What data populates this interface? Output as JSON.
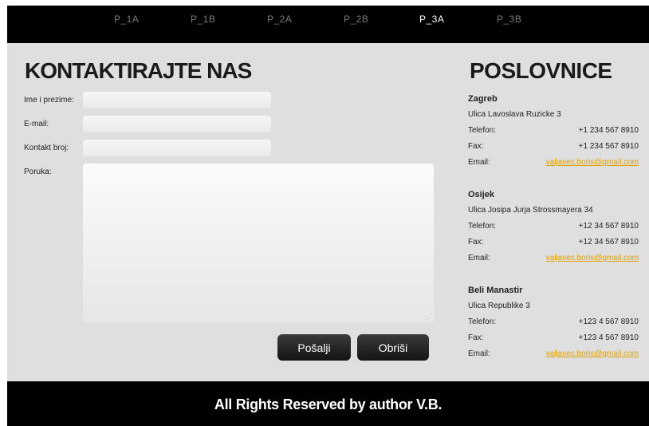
{
  "nav": {
    "items": [
      {
        "label": "P_1A",
        "active": false
      },
      {
        "label": "P_1B",
        "active": false
      },
      {
        "label": "P_2A",
        "active": false
      },
      {
        "label": "P_2B",
        "active": false
      },
      {
        "label": "P_3A",
        "active": true
      },
      {
        "label": "P_3B",
        "active": false
      }
    ]
  },
  "contact": {
    "title": "KONTAKTIRAJTE NAS",
    "fields": {
      "name_label": "Ime i prezime:",
      "email_label": "E-mail:",
      "phone_label": "Kontakt broj:",
      "message_label": "Poruka:",
      "name_value": "",
      "email_value": "",
      "phone_value": "",
      "message_value": ""
    },
    "buttons": {
      "send": "Pošalji",
      "clear": "Obriši"
    }
  },
  "offices": {
    "title": "POSLOVNICE",
    "phone_label": "Telefon:",
    "fax_label": "Fax:",
    "email_label": "Email:",
    "items": [
      {
        "city": "Zagreb",
        "address": "Ulica Lavoslava Ruzicke 3",
        "phone": "+1 234 567 8910",
        "fax": "+1 234 567 8910",
        "email": "valjavec.boris@gmail.com"
      },
      {
        "city": "Osijek",
        "address": "Ulica Josipa Jurja Strossmayera 34",
        "phone": "+12 34 567 8910",
        "fax": "+12 34 567 8910",
        "email": "valjavec.boris@gmail.com"
      },
      {
        "city": "Beli Manastir",
        "address": "Ulica Republike 3",
        "phone": "+123 4 567 8910",
        "fax": "+123 4 567 8910",
        "email": "valjavec.boris@gmail.com"
      }
    ]
  },
  "footer": {
    "text": "All Rights Reserved by author V.B."
  },
  "colors": {
    "nav_bg": "#000000",
    "page_bg": "#dfdfdf",
    "link": "#e0a000",
    "button_bg": "#1f1f1f"
  }
}
